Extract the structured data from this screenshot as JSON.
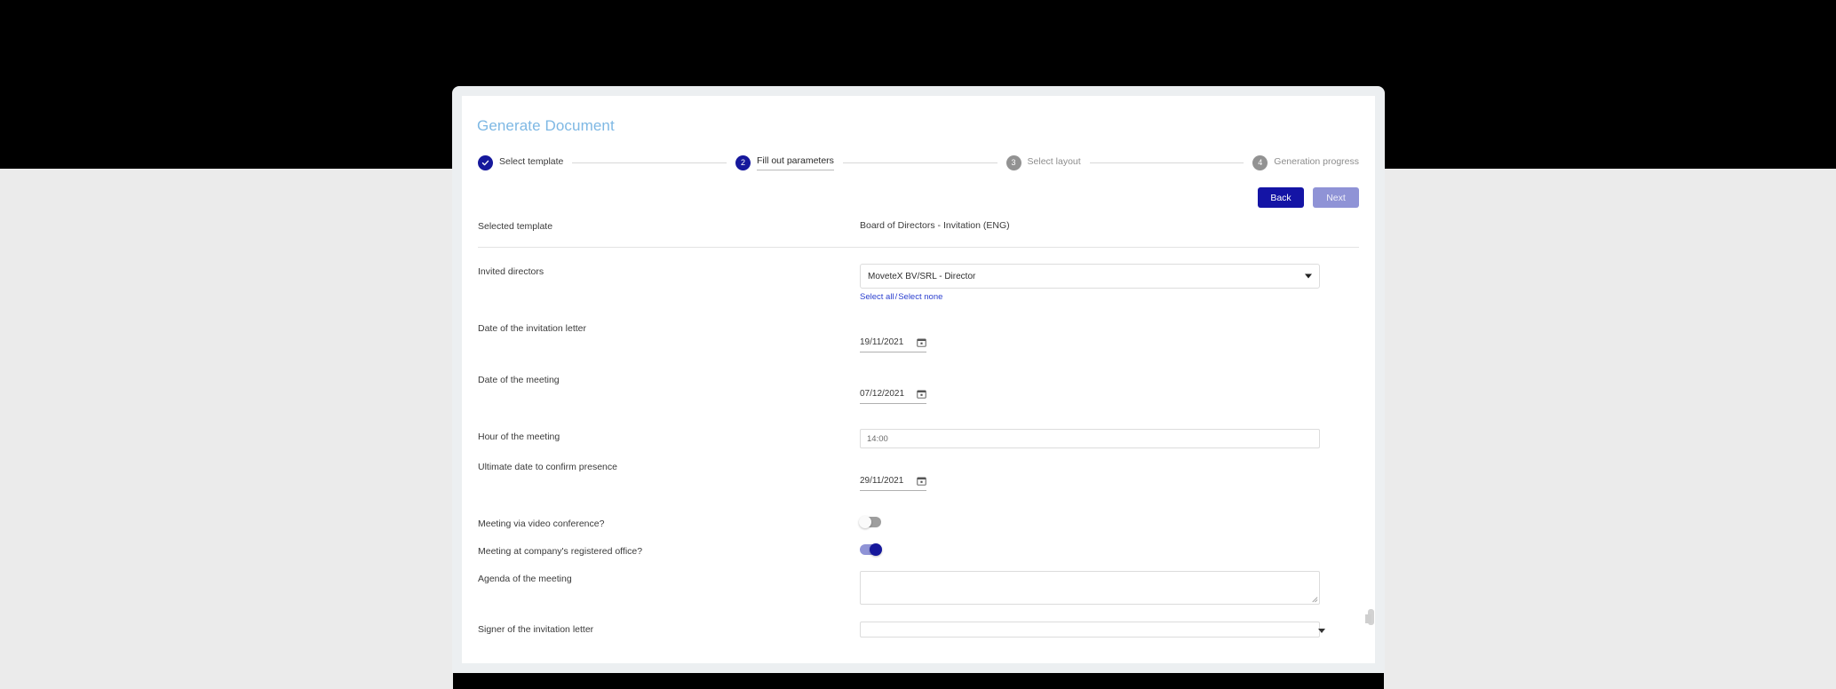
{
  "modal": {
    "title": "Generate Document"
  },
  "stepper": {
    "steps": [
      {
        "number": "",
        "label": "Select template",
        "state": "done",
        "icon": "check-icon"
      },
      {
        "number": "2",
        "label": "Fill out parameters",
        "state": "active"
      },
      {
        "number": "3",
        "label": "Select layout",
        "state": "todo"
      },
      {
        "number": "4",
        "label": "Generation progress",
        "state": "todo"
      }
    ]
  },
  "nav": {
    "back_label": "Back",
    "next_label": "Next"
  },
  "form": {
    "selected_template": {
      "label": "Selected template",
      "value": "Board of Directors - Invitation (ENG)"
    },
    "invited_directors": {
      "label": "Invited directors",
      "value": "MoveteX BV/SRL - Director",
      "select_all": "Select all",
      "separator": "/",
      "select_none": "Select none"
    },
    "date_invitation_letter": {
      "label": "Date of the invitation letter",
      "value": "19/11/2021"
    },
    "date_meeting": {
      "label": "Date of the meeting",
      "value": "07/12/2021"
    },
    "hour_meeting": {
      "label": "Hour of the meeting",
      "value": "14:00"
    },
    "ultimate_date": {
      "label": "Ultimate date to confirm presence",
      "value": "29/11/2021"
    },
    "video_conference": {
      "label": "Meeting via video conference?",
      "value": "off"
    },
    "registered_office": {
      "label": "Meeting at company's registered office?",
      "value": "on"
    },
    "agenda": {
      "label": "Agenda of the meeting",
      "value": ""
    },
    "signer": {
      "label": "Signer of the invitation letter",
      "value": ""
    }
  },
  "colors": {
    "title": "#7eb8e4",
    "primary": "#16189c",
    "primary_button": "#1414a5",
    "disabled_button": "#8f93d6",
    "link": "#2b3fcf",
    "modal_frame": "#eceff1",
    "toggle_off": "#9e9e9e",
    "step_todo": "#929292"
  }
}
